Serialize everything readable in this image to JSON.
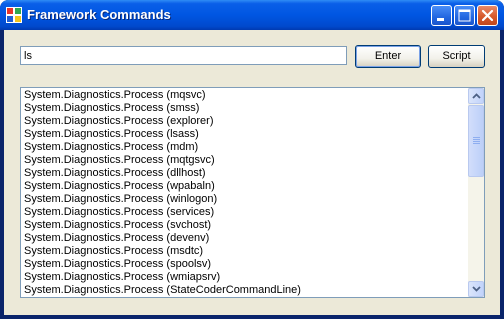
{
  "window": {
    "title": "Framework Commands",
    "icons": {
      "app": "app-window-icon",
      "minimize": "minimize-icon",
      "maximize": "maximize-icon",
      "close": "close-icon"
    }
  },
  "command": {
    "value": "ls",
    "enter_label": "Enter",
    "script_label": "Script"
  },
  "output": {
    "items": [
      "System.Diagnostics.Process (mqsvc)",
      "System.Diagnostics.Process (smss)",
      "System.Diagnostics.Process (explorer)",
      "System.Diagnostics.Process (lsass)",
      "System.Diagnostics.Process (mdm)",
      "System.Diagnostics.Process (mqtgsvc)",
      "System.Diagnostics.Process (dllhost)",
      "System.Diagnostics.Process (wpabaln)",
      "System.Diagnostics.Process (winlogon)",
      "System.Diagnostics.Process (services)",
      "System.Diagnostics.Process (svchost)",
      "System.Diagnostics.Process (devenv)",
      "System.Diagnostics.Process (msdtc)",
      "System.Diagnostics.Process (spoolsv)",
      "System.Diagnostics.Process (wmiapsrv)",
      "System.Diagnostics.Process (StateCoderCommandLine)"
    ],
    "scroll_icons": {
      "up": "scroll-up-arrow-icon",
      "down": "scroll-down-arrow-icon"
    }
  },
  "colors": {
    "titlebar": "#0054e3",
    "client_background": "#ece9d8",
    "close_button": "#d65a2c"
  }
}
